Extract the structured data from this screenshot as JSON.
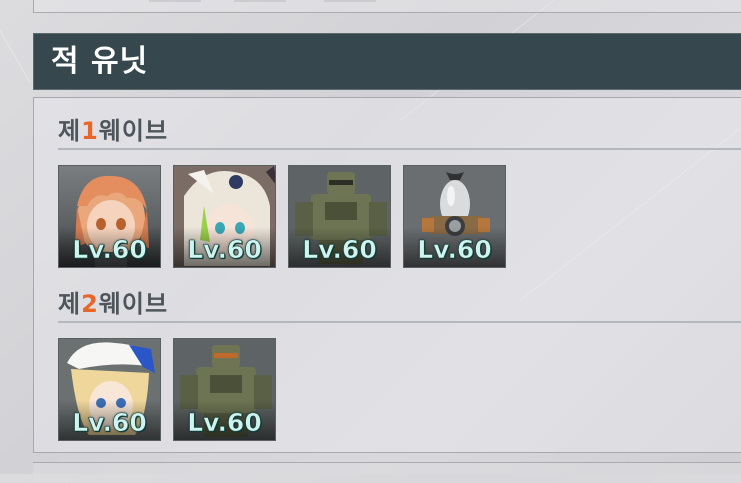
{
  "section": {
    "title": "적 유닛"
  },
  "waves": [
    {
      "prefix": "제",
      "number": "1",
      "suffix": "웨이브",
      "units": [
        {
          "name": "orange-hair-girl",
          "level": "Lv.60"
        },
        {
          "name": "white-hair-girl",
          "level": "Lv.60"
        },
        {
          "name": "green-mech",
          "level": "Lv.60"
        },
        {
          "name": "bomb-drone",
          "level": "Lv.60"
        }
      ]
    },
    {
      "prefix": "제",
      "number": "2",
      "suffix": "웨이브",
      "units": [
        {
          "name": "blonde-hat-girl",
          "level": "Lv.60"
        },
        {
          "name": "green-mech",
          "level": "Lv.60"
        }
      ]
    }
  ],
  "colors": {
    "header_bg": "#36474d",
    "accent": "#e8662a",
    "level_text": "#cff3ee"
  }
}
